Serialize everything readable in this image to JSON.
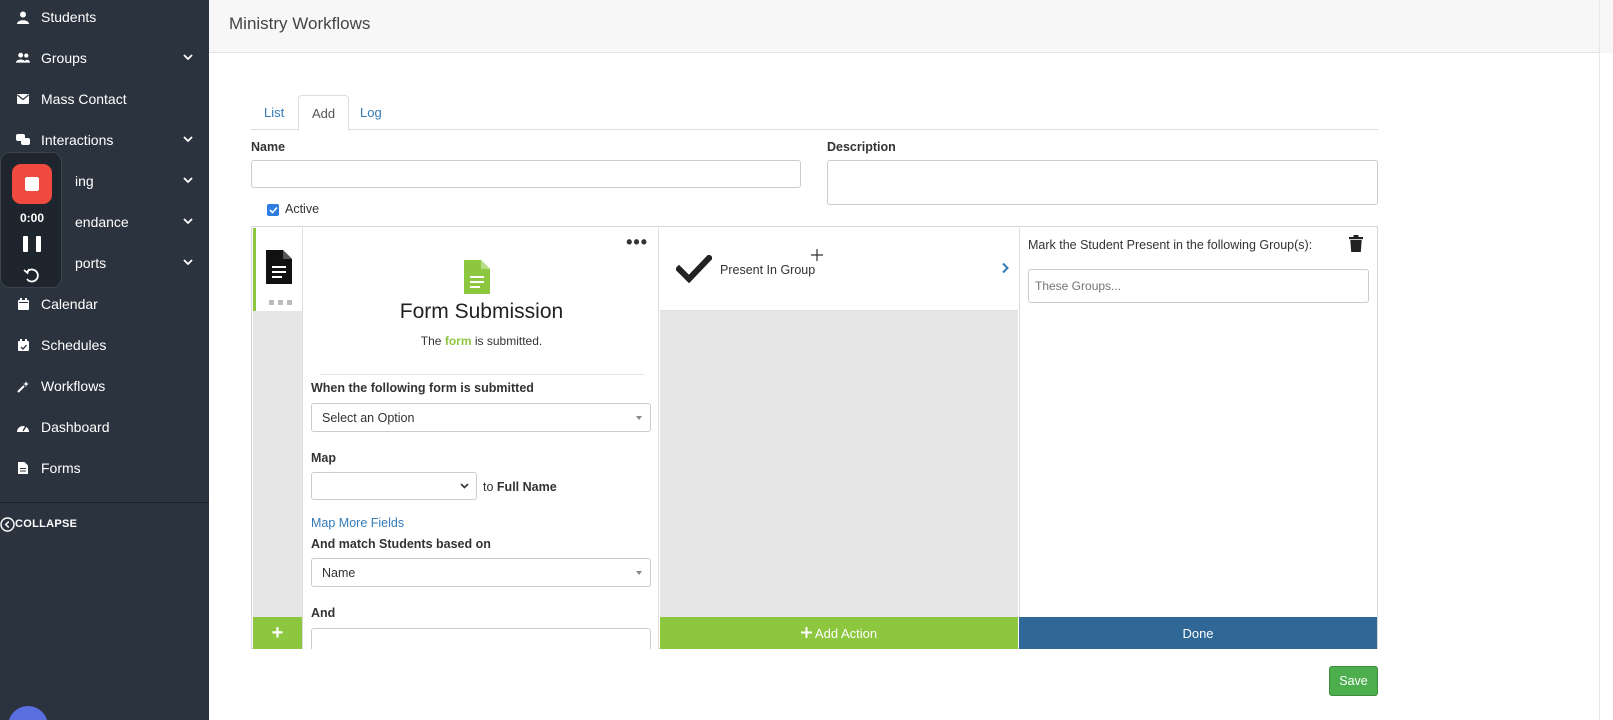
{
  "sidebar": {
    "items": [
      {
        "label": "Students",
        "icon": "user-icon",
        "has_chevron": false
      },
      {
        "label": "Groups",
        "icon": "users-icon",
        "has_chevron": true
      },
      {
        "label": "Mass Contact",
        "icon": "envelope-icon",
        "has_chevron": false
      },
      {
        "label": "Interactions",
        "icon": "comments-icon",
        "has_chevron": true
      },
      {
        "label": "ing",
        "icon": "tracking-icon",
        "has_chevron": true
      },
      {
        "label": "endance",
        "icon": "attendance-icon",
        "has_chevron": true
      },
      {
        "label": "ports",
        "icon": "reports-icon",
        "has_chevron": true
      },
      {
        "label": "Calendar",
        "icon": "calendar-icon",
        "has_chevron": false
      },
      {
        "label": "Schedules",
        "icon": "calendar-check-icon",
        "has_chevron": false
      },
      {
        "label": "Workflows",
        "icon": "magic-icon",
        "has_chevron": false
      },
      {
        "label": "Dashboard",
        "icon": "tachometer-icon",
        "has_chevron": false
      },
      {
        "label": "Forms",
        "icon": "file-icon",
        "has_chevron": false
      }
    ],
    "collapse_label": "COLLAPSE"
  },
  "recorder": {
    "time": "0:00"
  },
  "header": {
    "title": "Ministry Workflows"
  },
  "tabs": [
    {
      "label": "List",
      "active": false
    },
    {
      "label": "Add",
      "active": true
    },
    {
      "label": "Log",
      "active": false
    }
  ],
  "form": {
    "name_label": "Name",
    "name_value": "",
    "description_label": "Description",
    "description_value": "",
    "active_label": "Active",
    "active_checked": true
  },
  "trigger": {
    "title": "Form Submission",
    "sub_prefix": "The",
    "sub_link": "form",
    "sub_suffix": "is submitted.",
    "form_select_label": "When the following form is submitted",
    "form_select_value": "Select an Option",
    "map_label": "Map",
    "map_select_value": "",
    "map_to_prefix": "to",
    "map_to_field": "Full Name",
    "map_more_link": "Map More Fields",
    "match_label": "And match Students based on",
    "match_value": "Name",
    "and_label": "And"
  },
  "action": {
    "label": "Present In Group",
    "add_action_label": "Add Action"
  },
  "config": {
    "title": "Mark the Student Present in the following Group(s):",
    "groups_placeholder": "These Groups...",
    "done_label": "Done"
  },
  "save_label": "Save",
  "colors": {
    "sidebar_bg": "#2b333e",
    "accent_green": "#8dc63f",
    "done_blue": "#2f6796",
    "save_green": "#4cae4c",
    "link_blue": "#337ab7",
    "record_red": "#f04a3e"
  }
}
